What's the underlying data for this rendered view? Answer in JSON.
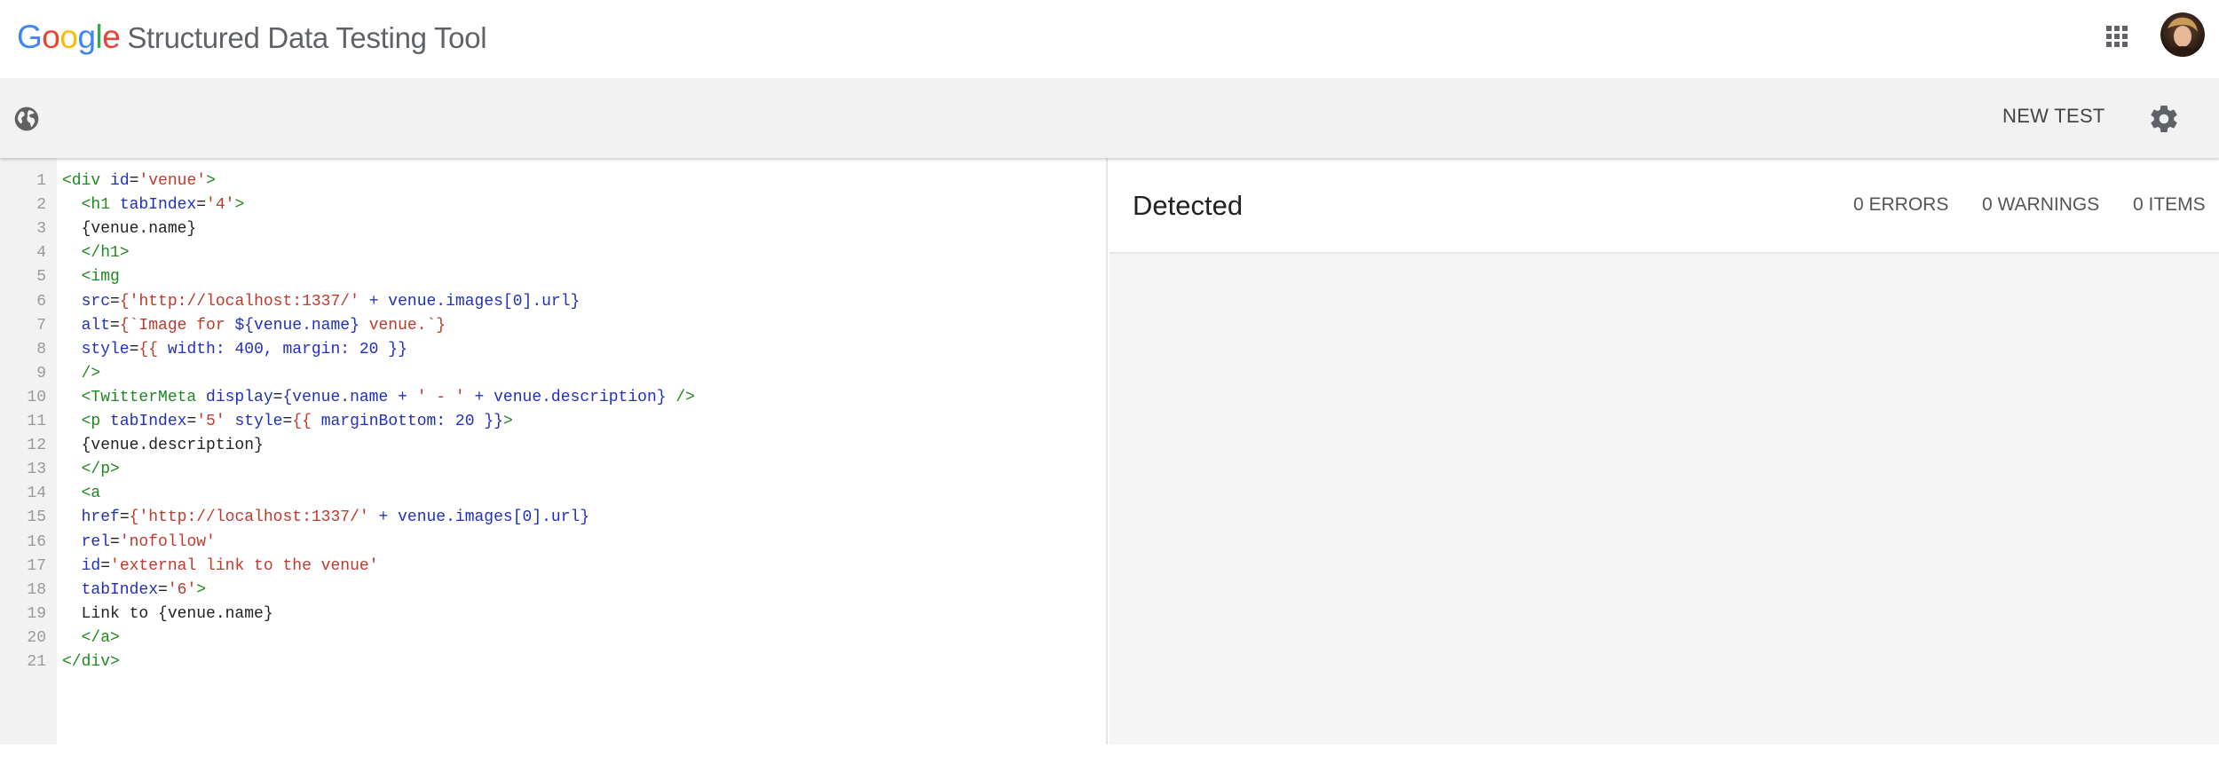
{
  "header": {
    "logo_letters": [
      "G",
      "o",
      "o",
      "g",
      "l",
      "e"
    ],
    "product_name": "Structured Data Testing Tool",
    "apps_icon": "apps-grid-icon",
    "avatar_icon": "user-avatar"
  },
  "toolbar": {
    "globe_icon": "globe-icon",
    "new_test_label": "NEW TEST",
    "settings_icon": "gear-icon"
  },
  "editor": {
    "lines": [
      {
        "n": "1",
        "tokens": [
          {
            "t": "<div ",
            "c": "tag"
          },
          {
            "t": "id",
            "c": "attr"
          },
          {
            "t": "=",
            "c": "plain"
          },
          {
            "t": "'venue'",
            "c": "str"
          },
          {
            "t": ">",
            "c": "tag"
          }
        ]
      },
      {
        "n": "2",
        "tokens": [
          {
            "t": "  <h1 ",
            "c": "tag"
          },
          {
            "t": "tabIndex",
            "c": "attr"
          },
          {
            "t": "=",
            "c": "plain"
          },
          {
            "t": "'4'",
            "c": "str"
          },
          {
            "t": ">",
            "c": "tag"
          }
        ]
      },
      {
        "n": "3",
        "tokens": [
          {
            "t": "  {venue.name}",
            "c": "plain"
          }
        ]
      },
      {
        "n": "4",
        "tokens": [
          {
            "t": "  </h1>",
            "c": "tag"
          }
        ]
      },
      {
        "n": "5",
        "tokens": [
          {
            "t": "  <img",
            "c": "tag"
          }
        ]
      },
      {
        "n": "6",
        "tokens": [
          {
            "t": "  src",
            "c": "attr"
          },
          {
            "t": "=",
            "c": "plain"
          },
          {
            "t": "{",
            "c": "brace"
          },
          {
            "t": "'http://localhost:1337/'",
            "c": "str"
          },
          {
            "t": " + venue.images[0].url}",
            "c": "jsx"
          }
        ]
      },
      {
        "n": "7",
        "tokens": [
          {
            "t": "  alt",
            "c": "attr"
          },
          {
            "t": "=",
            "c": "plain"
          },
          {
            "t": "{`Image for ",
            "c": "str"
          },
          {
            "t": "${venue.name}",
            "c": "jsx"
          },
          {
            "t": " venue.`}",
            "c": "str"
          }
        ]
      },
      {
        "n": "8",
        "tokens": [
          {
            "t": "  style",
            "c": "attr"
          },
          {
            "t": "=",
            "c": "plain"
          },
          {
            "t": "{{",
            "c": "brace"
          },
          {
            "t": " width: 400, margin: 20 }}",
            "c": "jsx"
          }
        ]
      },
      {
        "n": "9",
        "tokens": [
          {
            "t": "  />",
            "c": "tag"
          }
        ]
      },
      {
        "n": "10",
        "tokens": [
          {
            "t": "  <TwitterMeta ",
            "c": "tag"
          },
          {
            "t": "display",
            "c": "attr"
          },
          {
            "t": "=",
            "c": "plain"
          },
          {
            "t": "{venue.name + ",
            "c": "jsx"
          },
          {
            "t": "' - '",
            "c": "str"
          },
          {
            "t": " + venue.description} ",
            "c": "jsx"
          },
          {
            "t": "/>",
            "c": "tag"
          }
        ]
      },
      {
        "n": "11",
        "tokens": [
          {
            "t": "  <p ",
            "c": "tag"
          },
          {
            "t": "tabIndex",
            "c": "attr"
          },
          {
            "t": "=",
            "c": "plain"
          },
          {
            "t": "'5' ",
            "c": "str"
          },
          {
            "t": "style",
            "c": "attr"
          },
          {
            "t": "=",
            "c": "plain"
          },
          {
            "t": "{{",
            "c": "brace"
          },
          {
            "t": " marginBottom: 20 }}",
            "c": "jsx"
          },
          {
            "t": ">",
            "c": "tag"
          }
        ]
      },
      {
        "n": "12",
        "tokens": [
          {
            "t": "  {venue.description}",
            "c": "plain"
          }
        ]
      },
      {
        "n": "13",
        "tokens": [
          {
            "t": "  </p>",
            "c": "tag"
          }
        ]
      },
      {
        "n": "14",
        "tokens": [
          {
            "t": "  <a",
            "c": "tag"
          }
        ]
      },
      {
        "n": "15",
        "tokens": [
          {
            "t": "  href",
            "c": "attr"
          },
          {
            "t": "=",
            "c": "plain"
          },
          {
            "t": "{",
            "c": "brace"
          },
          {
            "t": "'http://localhost:1337/'",
            "c": "str"
          },
          {
            "t": " + venue.images[0].url}",
            "c": "jsx"
          }
        ]
      },
      {
        "n": "16",
        "tokens": [
          {
            "t": "  rel",
            "c": "attr"
          },
          {
            "t": "=",
            "c": "plain"
          },
          {
            "t": "'nofollow'",
            "c": "str"
          }
        ]
      },
      {
        "n": "17",
        "tokens": [
          {
            "t": "  id",
            "c": "attr"
          },
          {
            "t": "=",
            "c": "plain"
          },
          {
            "t": "'external link to the venue'",
            "c": "str"
          }
        ]
      },
      {
        "n": "18",
        "tokens": [
          {
            "t": "  tabIndex",
            "c": "attr"
          },
          {
            "t": "=",
            "c": "plain"
          },
          {
            "t": "'6'",
            "c": "str"
          },
          {
            "t": ">",
            "c": "tag"
          }
        ]
      },
      {
        "n": "19",
        "tokens": [
          {
            "t": "  Link to {venue.name}",
            "c": "plain"
          }
        ]
      },
      {
        "n": "20",
        "tokens": [
          {
            "t": "  </a>",
            "c": "tag"
          }
        ]
      },
      {
        "n": "21",
        "tokens": [
          {
            "t": "</div>",
            "c": "tag"
          }
        ]
      }
    ]
  },
  "results": {
    "title": "Detected",
    "errors": "0 ERRORS",
    "warnings": "0 WARNINGS",
    "items": "0 ITEMS"
  }
}
